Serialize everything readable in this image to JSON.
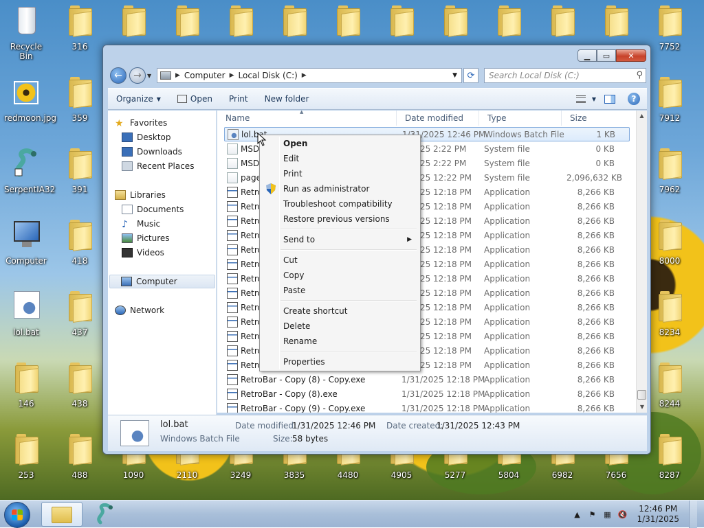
{
  "desktop": {
    "left_icons": [
      {
        "label": "Recycle Bin",
        "icon": "recycle-bin-icon"
      },
      {
        "label": "redmoon.jpg",
        "icon": "image-file-icon"
      },
      {
        "label": "SerpentIA32",
        "icon": "serpent-app-icon"
      },
      {
        "label": "Computer",
        "icon": "computer-icon"
      },
      {
        "label": "lol.bat",
        "icon": "batch-file-icon"
      },
      {
        "label": "146",
        "icon": "folder-icon"
      },
      {
        "label": "253",
        "icon": "folder-icon"
      }
    ],
    "col2_icons": [
      "316",
      "359",
      "391",
      "418",
      "437",
      "438",
      "488"
    ],
    "right_icons": [
      "7752",
      "7912",
      "7962",
      "8000",
      "8234",
      "8244",
      "8287"
    ],
    "bottom_icons": [
      "1090",
      "2110",
      "3249",
      "3835",
      "4480",
      "4905",
      "5277",
      "5804",
      "6982",
      "7656"
    ]
  },
  "window": {
    "address": {
      "crumbs": [
        "Computer",
        "Local Disk (C:)"
      ],
      "search_placeholder": "Search Local Disk (C:)"
    },
    "toolbar": {
      "organize": "Organize",
      "open": "Open",
      "print": "Print",
      "new_folder": "New folder"
    },
    "nav": {
      "favorites": "Favorites",
      "desktop": "Desktop",
      "downloads": "Downloads",
      "recent": "Recent Places",
      "libraries": "Libraries",
      "documents": "Documents",
      "music": "Music",
      "pictures": "Pictures",
      "videos": "Videos",
      "computer": "Computer",
      "network": "Network"
    },
    "columns": {
      "name": "Name",
      "date": "Date modified",
      "type": "Type",
      "size": "Size"
    },
    "files": [
      {
        "name": "lol.bat",
        "date": "1/31/2025 12:46 PM",
        "type": "Windows Batch File",
        "size": "1 KB",
        "kind": "bat"
      },
      {
        "name": "MSD",
        "date": "1/2025 2:22 PM",
        "type": "System file",
        "size": "0 KB",
        "kind": "sys"
      },
      {
        "name": "MSD",
        "date": "1/2025 2:22 PM",
        "type": "System file",
        "size": "0 KB",
        "kind": "sys"
      },
      {
        "name": "page",
        "date": "1/2025 12:22 PM",
        "type": "System file",
        "size": "2,096,632 KB",
        "kind": "sys"
      },
      {
        "name": "Retro",
        "date": "1/2025 12:18 PM",
        "type": "Application",
        "size": "8,266 KB",
        "kind": "exe"
      },
      {
        "name": "Retro",
        "date": "1/2025 12:18 PM",
        "type": "Application",
        "size": "8,266 KB",
        "kind": "exe"
      },
      {
        "name": "Retro",
        "date": "1/2025 12:18 PM",
        "type": "Application",
        "size": "8,266 KB",
        "kind": "exe"
      },
      {
        "name": "Retro",
        "date": "1/2025 12:18 PM",
        "type": "Application",
        "size": "8,266 KB",
        "kind": "exe"
      },
      {
        "name": "Retro",
        "date": "1/2025 12:18 PM",
        "type": "Application",
        "size": "8,266 KB",
        "kind": "exe"
      },
      {
        "name": "Retro",
        "date": "1/2025 12:18 PM",
        "type": "Application",
        "size": "8,266 KB",
        "kind": "exe"
      },
      {
        "name": "Retro",
        "date": "1/2025 12:18 PM",
        "type": "Application",
        "size": "8,266 KB",
        "kind": "exe"
      },
      {
        "name": "Retro",
        "date": "1/2025 12:18 PM",
        "type": "Application",
        "size": "8,266 KB",
        "kind": "exe"
      },
      {
        "name": "Retro",
        "date": "1/2025 12:18 PM",
        "type": "Application",
        "size": "8,266 KB",
        "kind": "exe"
      },
      {
        "name": "Retro",
        "date": "1/2025 12:18 PM",
        "type": "Application",
        "size": "8,266 KB",
        "kind": "exe"
      },
      {
        "name": "Retro",
        "date": "1/2025 12:18 PM",
        "type": "Application",
        "size": "8,266 KB",
        "kind": "exe"
      },
      {
        "name": "Retro",
        "date": "1/2025 12:18 PM",
        "type": "Application",
        "size": "8,266 KB",
        "kind": "exe"
      },
      {
        "name": "Retro",
        "date": "1/2025 12:18 PM",
        "type": "Application",
        "size": "8,266 KB",
        "kind": "exe"
      },
      {
        "name": "RetroBar - Copy (8) - Copy.exe",
        "date": "1/31/2025 12:18 PM",
        "type": "Application",
        "size": "8,266 KB",
        "kind": "exe"
      },
      {
        "name": "RetroBar - Copy (8).exe",
        "date": "1/31/2025 12:18 PM",
        "type": "Application",
        "size": "8,266 KB",
        "kind": "exe"
      },
      {
        "name": "RetroBar - Copy (9) - Copy.exe",
        "date": "1/31/2025 12:18 PM",
        "type": "Application",
        "size": "8,266 KB",
        "kind": "exe"
      }
    ],
    "details": {
      "name": "lol.bat",
      "type": "Windows Batch File",
      "modified_label": "Date modified:",
      "modified": "1/31/2025 12:46 PM",
      "created_label": "Date created:",
      "created": "1/31/2025 12:43 PM",
      "size_label": "Size:",
      "size": "58 bytes"
    }
  },
  "context_menu": {
    "open": "Open",
    "edit": "Edit",
    "print": "Print",
    "run_admin": "Run as administrator",
    "troubleshoot": "Troubleshoot compatibility",
    "restore": "Restore previous versions",
    "send_to": "Send to",
    "cut": "Cut",
    "copy": "Copy",
    "paste": "Paste",
    "create_shortcut": "Create shortcut",
    "delete": "Delete",
    "rename": "Rename",
    "properties": "Properties"
  },
  "taskbar": {
    "time": "12:46 PM",
    "date": "1/31/2025"
  },
  "colors": {
    "selection": "#dcebfc",
    "accent": "#2a66b8",
    "close": "#c7422a"
  }
}
